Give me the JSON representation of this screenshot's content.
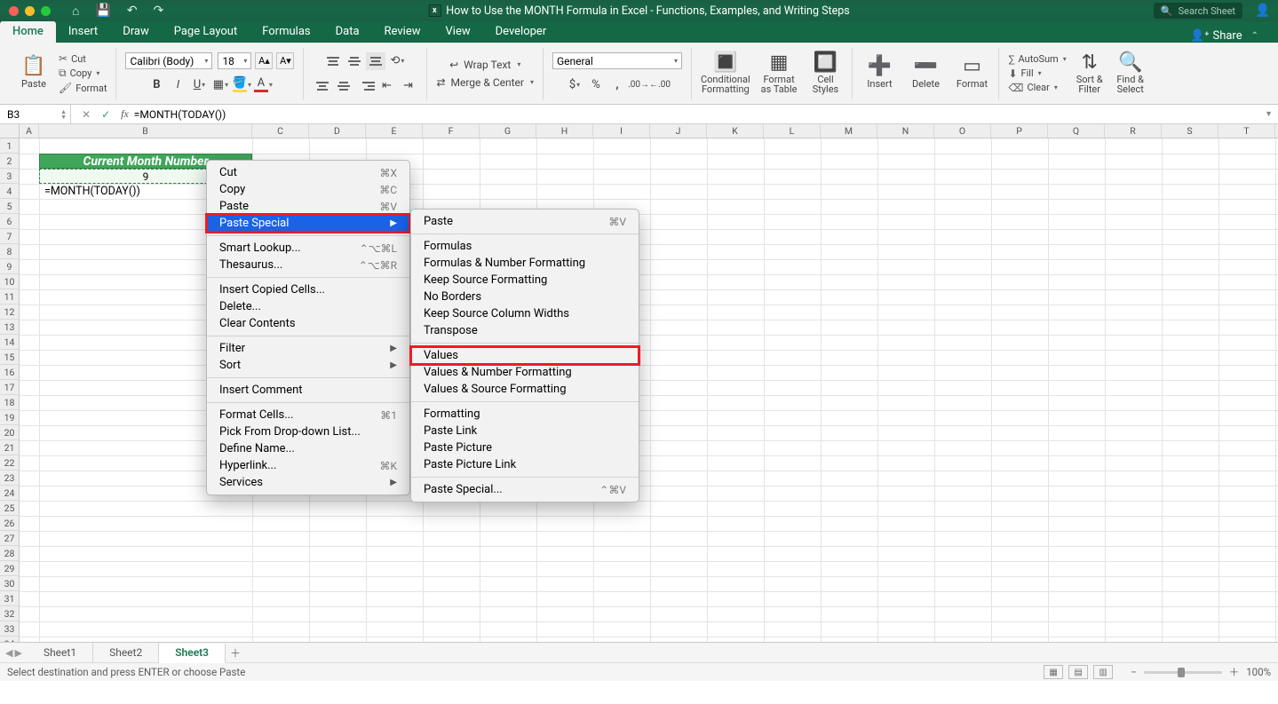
{
  "window": {
    "title": "How to Use the MONTH Formula in Excel - Functions, Examples, and Writing Steps",
    "search_placeholder": "Search Sheet"
  },
  "tabs": {
    "items": [
      "Home",
      "Insert",
      "Draw",
      "Page Layout",
      "Formulas",
      "Data",
      "Review",
      "View",
      "Developer"
    ],
    "active": 0,
    "share": "Share"
  },
  "clipboard": {
    "paste": "Paste",
    "cut": "Cut",
    "copy": "Copy",
    "format": "Format"
  },
  "font": {
    "name": "Calibri (Body)",
    "size": "18"
  },
  "alignment": {
    "wrap": "Wrap Text",
    "merge": "Merge & Center"
  },
  "number": {
    "format": "General"
  },
  "styles": {
    "cf": "Conditional\nFormatting",
    "fat": "Format\nas Table",
    "cs": "Cell\nStyles"
  },
  "cells": {
    "insert": "Insert",
    "delete": "Delete",
    "format": "Format"
  },
  "editing": {
    "autosum": "AutoSum",
    "fill": "Fill",
    "clear": "Clear",
    "sort": "Sort &\nFilter",
    "find": "Find &\nSelect"
  },
  "formula_bar": {
    "ref": "B3",
    "formula": "=MONTH(TODAY())"
  },
  "columns": [
    "A",
    "B",
    "C",
    "D",
    "E",
    "F",
    "G",
    "H",
    "I",
    "J",
    "K",
    "L",
    "M",
    "N",
    "O",
    "P",
    "Q",
    "R",
    "S",
    "T"
  ],
  "sheet": {
    "header_cell": "Current Month Number",
    "value_cell": "9",
    "formula_cell": "=MONTH(TODAY())"
  },
  "ctx1": {
    "cut": {
      "t": "Cut",
      "k": "⌘X"
    },
    "copy": {
      "t": "Copy",
      "k": "⌘C"
    },
    "paste": {
      "t": "Paste",
      "k": "⌘V"
    },
    "pspecial": "Paste Special",
    "smart": {
      "t": "Smart Lookup...",
      "k": "⌃⌥⌘L"
    },
    "thes": {
      "t": "Thesaurus...",
      "k": "⌃⌥⌘R"
    },
    "icc": "Insert Copied Cells...",
    "del": "Delete...",
    "clear": "Clear Contents",
    "filter": "Filter",
    "sort": "Sort",
    "comment": "Insert Comment",
    "fcell": {
      "t": "Format Cells...",
      "k": "⌘1"
    },
    "pick": "Pick From Drop-down List...",
    "defn": "Define Name...",
    "hyper": {
      "t": "Hyperlink...",
      "k": "⌘K"
    },
    "services": "Services"
  },
  "ctx2": {
    "paste": {
      "t": "Paste",
      "k": "⌘V"
    },
    "formulas": "Formulas",
    "fnf": "Formulas & Number Formatting",
    "ksf": "Keep Source Formatting",
    "nob": "No Borders",
    "kscw": "Keep Source Column Widths",
    "trans": "Transpose",
    "values": "Values",
    "vnf": "Values & Number Formatting",
    "vsf": "Values & Source Formatting",
    "fmt": "Formatting",
    "plink": "Paste Link",
    "ppic": "Paste Picture",
    "ppicl": "Paste Picture Link",
    "psp": {
      "t": "Paste Special...",
      "k": "⌃⌘V"
    }
  },
  "sheets": {
    "items": [
      "Sheet1",
      "Sheet2",
      "Sheet3"
    ],
    "active": 2
  },
  "status": {
    "msg": "Select destination and press ENTER or choose Paste",
    "zoom": "100%"
  }
}
